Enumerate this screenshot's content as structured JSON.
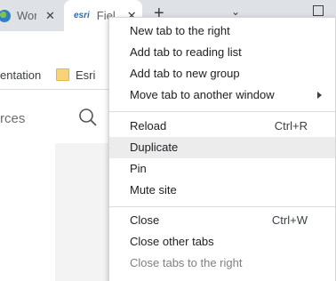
{
  "tabs": [
    {
      "title": "Wor",
      "icon": "globe-icon"
    },
    {
      "title": "Fiel",
      "logo": "esri",
      "icon": "esri-logo-icon"
    }
  ],
  "bookmarks": {
    "item1": "entation",
    "item2": "Esri"
  },
  "search": {
    "placeholder": "rces"
  },
  "context_menu": {
    "group1": [
      {
        "label": "New tab to the right"
      },
      {
        "label": "Add tab to reading list"
      },
      {
        "label": "Add tab to new group"
      },
      {
        "label": "Move tab to another window",
        "submenu": true
      }
    ],
    "group2": [
      {
        "label": "Reload",
        "shortcut": "Ctrl+R"
      },
      {
        "label": "Duplicate",
        "highlighted": true
      },
      {
        "label": "Pin"
      },
      {
        "label": "Mute site"
      }
    ],
    "group3": [
      {
        "label": "Close",
        "shortcut": "Ctrl+W"
      },
      {
        "label": "Close other tabs"
      },
      {
        "label": "Close tabs to the right",
        "disabled": true
      }
    ]
  },
  "colors": {
    "tabstrip": "#dee1e6",
    "highlight": "#ececec",
    "esri_blue": "#1c6fc1"
  }
}
